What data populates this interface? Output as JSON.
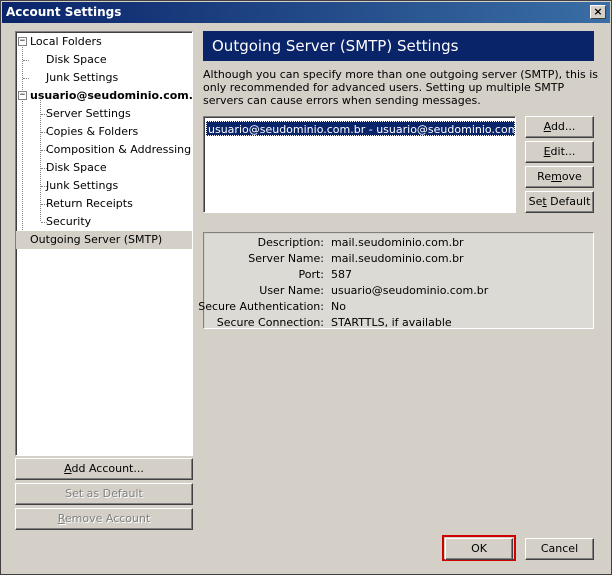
{
  "window": {
    "title": "Account Settings",
    "close_glyph": "×"
  },
  "tree": {
    "items": [
      {
        "label": "Local Folders",
        "toggle": "−"
      },
      {
        "label": "Disk Space"
      },
      {
        "label": "Junk Settings"
      },
      {
        "label": "usuario@seudominio.com.br",
        "toggle": "−"
      },
      {
        "label": "Server Settings"
      },
      {
        "label": "Copies & Folders"
      },
      {
        "label": "Composition & Addressing"
      },
      {
        "label": "Disk Space"
      },
      {
        "label": "Junk Settings"
      },
      {
        "label": "Return Receipts"
      },
      {
        "label": "Security"
      },
      {
        "label": "Outgoing Server (SMTP)"
      }
    ]
  },
  "left_buttons": {
    "add_account": {
      "pre": "",
      "u": "A",
      "post": "dd Account..."
    },
    "set_default": "Set as Default",
    "remove_account": {
      "pre": "",
      "u": "R",
      "post": "emove Account"
    }
  },
  "panel": {
    "title": "Outgoing Server (SMTP) Settings",
    "description": "Although you can specify more than one outgoing server (SMTP), this is only recommended for advanced users. Setting up multiple SMTP servers can cause errors when sending messages.",
    "server_item": "usuario@seudominio.com.br - usuario@seudominio.com.br (Default)"
  },
  "server_buttons": {
    "add": {
      "pre": "",
      "u": "A",
      "post": "dd..."
    },
    "edit": {
      "pre": "",
      "u": "E",
      "post": "dit..."
    },
    "remove": {
      "pre": "Re",
      "u": "m",
      "post": "ove"
    },
    "set_default": {
      "pre": "Se",
      "u": "t",
      "post": " Default"
    }
  },
  "details": [
    {
      "label": "Description:",
      "value": "mail.seudominio.com.br"
    },
    {
      "label": "Server Name:",
      "value": "mail.seudominio.com.br"
    },
    {
      "label": "Port:",
      "value": "587"
    },
    {
      "label": "User Name:",
      "value": "usuario@seudominio.com.br"
    },
    {
      "label": "Secure Authentication:",
      "value": "No"
    },
    {
      "label": "Secure Connection:",
      "value": "STARTTLS, if available"
    }
  ],
  "footer": {
    "ok": "OK",
    "cancel": "Cancel"
  }
}
